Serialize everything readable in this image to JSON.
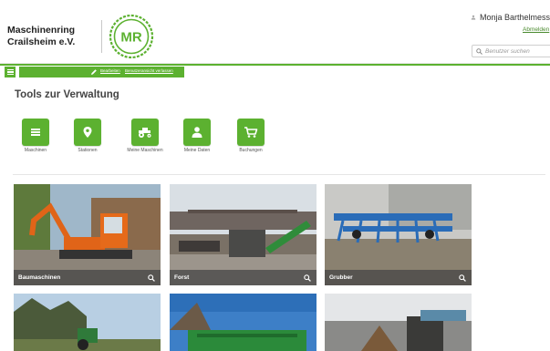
{
  "header": {
    "org_name_line1": "Maschinenring",
    "org_name_line2": "Crailsheim e.V.",
    "logo_text": "MR",
    "user_name": "Monja Barthelmess",
    "logout_label": "Abmelden",
    "search_placeholder": "Benutzer suchen"
  },
  "toolbar": {
    "link1": "Bearbeiten",
    "link2": "Benutzeransicht verlassen"
  },
  "page": {
    "title": "Tools zur Verwaltung"
  },
  "tools": [
    {
      "label": "Maschinen",
      "icon": "list-icon"
    },
    {
      "label": "Stationen",
      "icon": "map-pin-icon"
    },
    {
      "label": "Meine Maschinen",
      "icon": "tractor-icon"
    },
    {
      "label": "Meine Daten",
      "icon": "person-icon"
    },
    {
      "label": "Buchungen",
      "icon": "cart-icon"
    }
  ],
  "categories": [
    {
      "label": "Baumaschinen"
    },
    {
      "label": "Forst"
    },
    {
      "label": "Grubber"
    },
    {
      "label": ""
    },
    {
      "label": ""
    },
    {
      "label": ""
    }
  ],
  "colors": {
    "brand_green": "#5cb130",
    "caption_bg": "#464646"
  }
}
